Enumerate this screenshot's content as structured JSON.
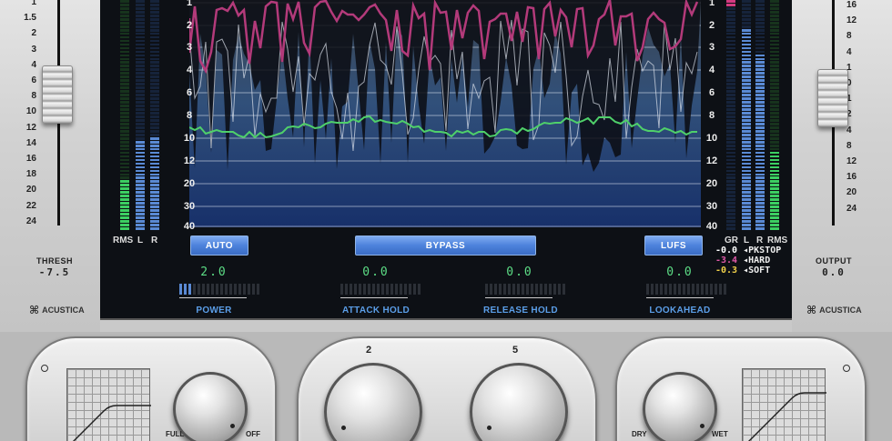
{
  "left": {
    "scale": [
      "1",
      "1.5",
      "2",
      "3",
      "4",
      "6",
      "8",
      "10",
      "12",
      "14",
      "16",
      "18",
      "20",
      "22",
      "24"
    ],
    "label": "THRESH",
    "value": "-7.5",
    "brand": "ACUSTICA"
  },
  "right": {
    "scale": [
      "16",
      "12",
      "8",
      "4",
      "1",
      "0",
      "1",
      "2",
      "4",
      "8",
      "12",
      "16",
      "20",
      "24"
    ],
    "label": "OUTPUT",
    "value": "0.0",
    "brand": "ACUSTICA"
  },
  "graph": {
    "axis": [
      "1",
      "2",
      "3",
      "4",
      "6",
      "8",
      "10",
      "12",
      "20",
      "30",
      "40"
    ]
  },
  "meters": {
    "left_heads": [
      "RMS",
      "L",
      "R"
    ],
    "right_heads": [
      "GR",
      "L",
      "R",
      "RMS"
    ]
  },
  "buttons": {
    "auto": "AUTO",
    "bypass": "BYPASS",
    "lufs": "LUFS"
  },
  "legend": [
    {
      "value": "-0.0",
      "label": "◂PKSTOP",
      "color": "#ffffff"
    },
    {
      "value": "-3.4",
      "label": "◂HARD",
      "color": "#e05aa8"
    },
    {
      "value": "-0.3",
      "label": "◂SOFT",
      "color": "#f2d24a"
    }
  ],
  "controls": [
    {
      "value": "2.0",
      "label": "POWER",
      "level": 0.15
    },
    {
      "value": "0.0",
      "label": "ATTACK HOLD",
      "level": 0
    },
    {
      "value": "0.0",
      "label": "RELEASE HOLD",
      "level": 0
    },
    {
      "value": "0.0",
      "label": "LOOKAHEAD",
      "level": 0
    }
  ],
  "bottom": {
    "knob1_left": "FULL",
    "knob1_right": "OFF",
    "knob2_top": "2",
    "knob3_top": "5",
    "knob4_left": "DRY",
    "knob4_right": "WET"
  },
  "colors": {
    "accent_blue": "#4d82dc",
    "meter_green": "#3ccf62",
    "meter_blue": "#5a8ad4",
    "gr_line": "#b33a7a",
    "rms_line": "#4fd06a"
  }
}
